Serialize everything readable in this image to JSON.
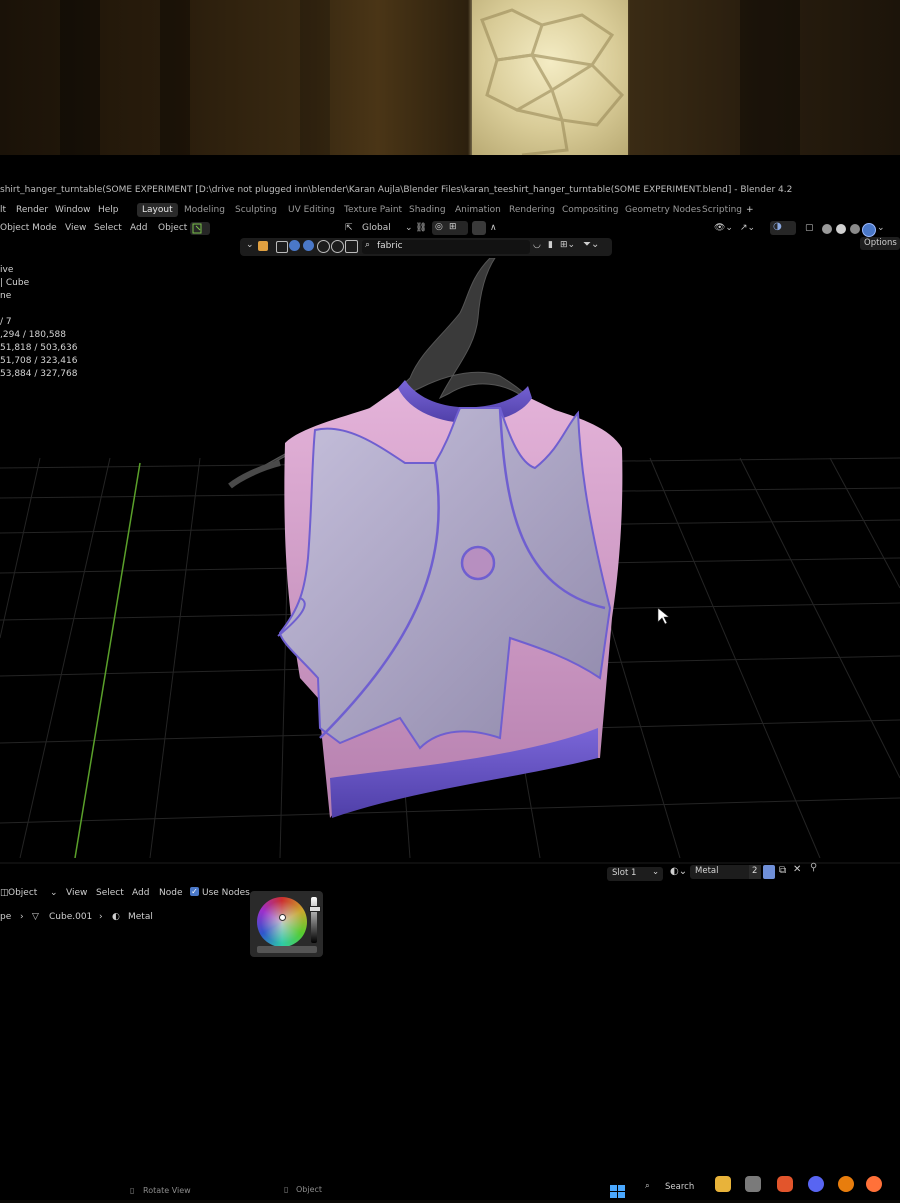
{
  "titlebar": {
    "text": "shirt_hanger_turntable(SOME EXPERIMENT [D:\\drive not plugged inn\\blender\\Karan Aujla\\Blender Files\\karan_teeshirt_hanger_turntable(SOME EXPERIMENT.blend] - Blender 4.2"
  },
  "menu": {
    "items": [
      "lt",
      "Render",
      "Window",
      "Help"
    ]
  },
  "workspaces": {
    "items": [
      "Layout",
      "Modeling",
      "Sculpting",
      "UV Editing",
      "Texture Paint",
      "Shading",
      "Animation",
      "Rendering",
      "Compositing",
      "Geometry Nodes",
      "Scripting"
    ],
    "active": "Layout",
    "add": "+"
  },
  "viewport_header": {
    "mode": "Object Mode",
    "menus": [
      "View",
      "Select",
      "Add",
      "Object"
    ],
    "transform": "Global",
    "options": "Options"
  },
  "outliner_filter": {
    "search_value": "fabric"
  },
  "stats": {
    "lines": [
      "ive",
      "| Cube",
      "ne",
      "",
      "/ 7",
      ",294 / 180,588",
      "51,818 / 503,636",
      "51,708 / 323,416",
      "53,884 / 327,768"
    ]
  },
  "node_editor": {
    "object_mode": "Object",
    "menus": [
      "View",
      "Select",
      "Add",
      "Node"
    ],
    "use_nodes_label": "Use Nodes",
    "slot": "Slot 1",
    "material": "Metal",
    "material_users": "2",
    "breadcrumb": {
      "prefix": "pe",
      "object": "Cube.001",
      "material": "Metal"
    }
  },
  "statusbar": {
    "left": "Rotate View",
    "middle": "Object"
  },
  "taskbar": {
    "search": "Search"
  },
  "colors": {
    "shirt_pink": "#d9a6cf",
    "shirt_gray": "#b9b3d2",
    "trim_purple": "#6f5fd0",
    "grid_line": "#2a2a2a",
    "y_axis": "#5aa02a"
  }
}
